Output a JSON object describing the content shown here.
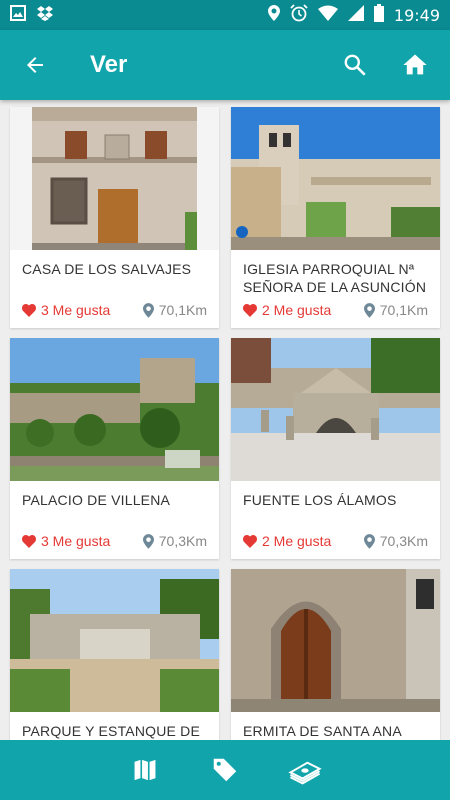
{
  "status": {
    "time": "19:49"
  },
  "app_bar": {
    "title": "Ver"
  },
  "colors": {
    "primary": "#11a5ab",
    "status_bar": "#0a8a91",
    "like": "#e53935",
    "distance": "#888888"
  },
  "cards": [
    {
      "title": "CASA DE LOS SALVAJES",
      "likes": "3 Me gusta",
      "distance": "70,1Km"
    },
    {
      "title": "IGLESIA PARROQUIAL Nª SEÑORA DE LA ASUNCIÓN",
      "likes": "2 Me gusta",
      "distance": "70,1Km"
    },
    {
      "title": "PALACIO DE VILLENA",
      "likes": "3 Me gusta",
      "distance": "70,3Km"
    },
    {
      "title": "FUENTE LOS ÁLAMOS",
      "likes": "2 Me gusta",
      "distance": "70,3Km"
    },
    {
      "title": "PARQUE Y ESTANQUE DE",
      "likes": "",
      "distance": ""
    },
    {
      "title": "ERMITA DE SANTA ANA",
      "likes": "",
      "distance": ""
    }
  ],
  "icons": {
    "status": [
      "image-icon",
      "dropbox-icon",
      "location-icon",
      "alarm-icon",
      "wifi-icon",
      "cell-signal-icon",
      "battery-icon"
    ],
    "app_bar": [
      "back-arrow-icon",
      "search-icon",
      "home-icon"
    ],
    "bottom_bar": [
      "map-icon",
      "tag-icon",
      "money-icon"
    ]
  }
}
